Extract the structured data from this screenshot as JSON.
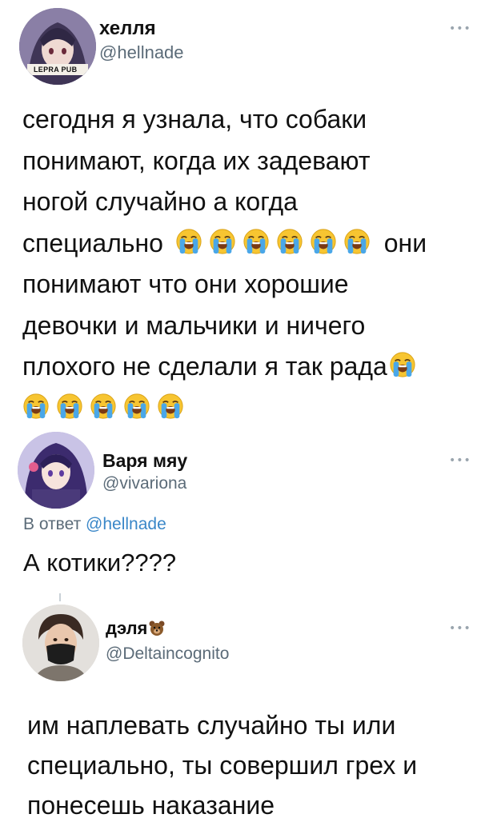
{
  "tweets": [
    {
      "name": "хелля",
      "handle": "@hellnade",
      "avatar_badge": "LEPRA PUB",
      "more_icon": "more-dots-icon",
      "lines": [
        "сегодня я узнала, что собаки",
        "понимают, когда их задевают",
        "ногой случайно а когда",
        "специально",
        "они",
        "понимают что они хорошие",
        "девочки и мальчики и ничего",
        "плохого не сделали я так рада"
      ],
      "emoji_icon": "loudly-crying-face-icon"
    },
    {
      "name": "Варя мяу",
      "handle": "@vivariona",
      "reply_prefix": "В ответ",
      "reply_handle": "@hellnade",
      "text": "А котики????"
    },
    {
      "name": "дэля",
      "name_emoji": "bear-face-icon",
      "handle": "@Deltaincognito",
      "lines": [
        "им наплевать случайно ты или",
        "специально, ты совершил грех и",
        "понесешь наказание"
      ]
    }
  ],
  "colors": {
    "text": "#111111",
    "secondary": "#5b6b78",
    "link": "#3a87c8",
    "emoji_face": "#f7c531",
    "emoji_tears": "#4aa7e8"
  }
}
